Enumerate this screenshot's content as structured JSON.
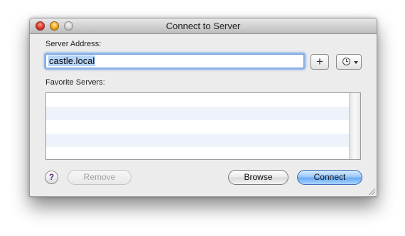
{
  "window": {
    "title": "Connect to Server"
  },
  "server_address": {
    "label": "Server Address:",
    "value": "castle.local",
    "add_label": "+"
  },
  "favorites": {
    "label": "Favorite Servers:",
    "items": []
  },
  "buttons": {
    "help_label": "?",
    "remove_label": "Remove",
    "browse_label": "Browse",
    "connect_label": "Connect"
  },
  "icons": {
    "recent": "clock-icon",
    "recent_menu": "chevron-down-icon",
    "resize": "resize-grip-icon"
  },
  "colors": {
    "default_button": "#6aa9f3",
    "focus_ring": "#8fb6ea",
    "row_stripe": "#eef3fb"
  }
}
